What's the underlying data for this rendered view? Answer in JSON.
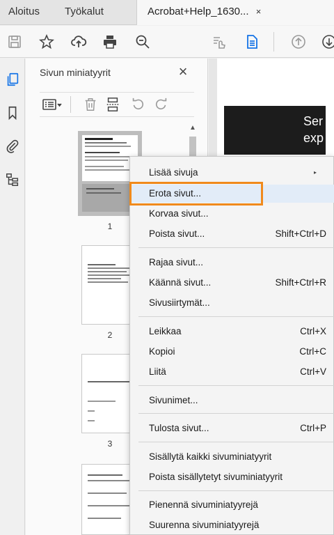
{
  "tabs": {
    "home": "Aloitus",
    "tools": "Työkalut",
    "document": "Acrobat+Help_1630...",
    "document_close": "×"
  },
  "toolbar": {
    "icons": [
      "save-icon",
      "star-icon",
      "cloud-upload-icon",
      "print-icon",
      "zoom-out-icon",
      "hand-sign-icon",
      "page-thumbnail-icon",
      "page-up-icon",
      "page-down-icon"
    ],
    "accent": "#1473e6"
  },
  "rail": {
    "icons": [
      "pages-icon",
      "bookmark-icon",
      "attachment-icon",
      "layers-icon"
    ]
  },
  "panel": {
    "title": "Sivun miniatyyrit",
    "close": "×",
    "thumbnails": [
      {
        "number": "1"
      },
      {
        "number": "2"
      },
      {
        "number": "3"
      }
    ]
  },
  "document": {
    "banner_text_line1": "Ser",
    "banner_text_line2": "exp"
  },
  "context_menu": {
    "items": [
      {
        "label": "Lisää sivuja",
        "shortcut": "",
        "submenu": "▸"
      },
      {
        "label": "Erota sivut...",
        "shortcut": "",
        "highlighted": true
      },
      {
        "label": "Korvaa sivut...",
        "shortcut": ""
      },
      {
        "label": "Poista sivut...",
        "shortcut": "Shift+Ctrl+D"
      },
      {
        "label": "Rajaa sivut...",
        "shortcut": ""
      },
      {
        "label": "Käännä sivut...",
        "shortcut": "Shift+Ctrl+R"
      },
      {
        "label": "Sivusiirtymät...",
        "shortcut": ""
      },
      {
        "label": "Leikkaa",
        "shortcut": "Ctrl+X"
      },
      {
        "label": "Kopioi",
        "shortcut": "Ctrl+C"
      },
      {
        "label": "Liitä",
        "shortcut": "Ctrl+V"
      },
      {
        "label": "Sivunimet...",
        "shortcut": ""
      },
      {
        "label": "Tulosta sivut...",
        "shortcut": "Ctrl+P"
      },
      {
        "label": "Sisällytä kaikki sivuminiatyyrit",
        "shortcut": ""
      },
      {
        "label": "Poista sisällytetyt sivuminiatyyrit",
        "shortcut": ""
      },
      {
        "label": "Pienennä sivuminiatyyrejä",
        "shortcut": ""
      },
      {
        "label": "Suurenna sivuminiatyyrejä",
        "shortcut": ""
      }
    ],
    "highlight_color": "#f08a1c"
  }
}
